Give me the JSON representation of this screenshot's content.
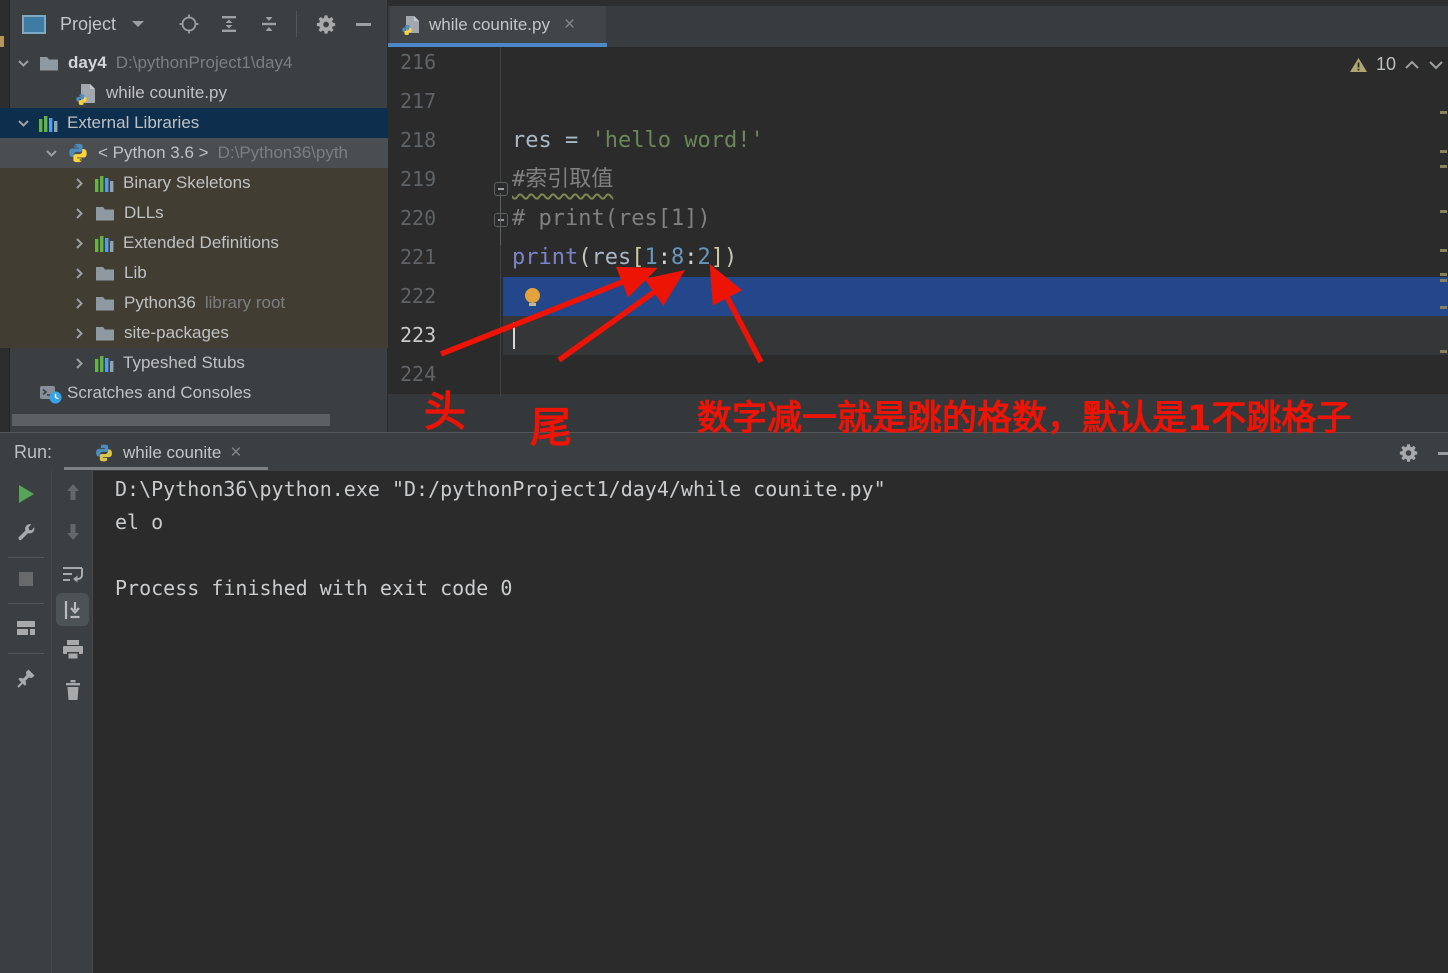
{
  "colors": {
    "selection_blue": "#24468a",
    "tab_accent_blue": "#4a88c7",
    "annotation_red": "#ee1405",
    "string_green": "#6a8759",
    "number_blue": "#6897bb",
    "run_play_green": "#57a558"
  },
  "project_panel": {
    "title": "Project",
    "tree": {
      "day4": {
        "label": "day4",
        "path": "D:\\pythonProject1\\day4"
      },
      "file": "while counite.py",
      "external_libraries": "External Libraries",
      "python36": {
        "label": "< Python 3.6 >",
        "path": "D:\\Python36\\pyth"
      },
      "binary_skeletons": "Binary Skeletons",
      "dlls": "DLLs",
      "extended_definitions": "Extended Definitions",
      "lib": "Lib",
      "python36_dir": {
        "label": "Python36",
        "annotation": "library root"
      },
      "site_packages": "site-packages",
      "typeshed_stubs": "Typeshed Stubs",
      "scratches": "Scratches and Consoles"
    }
  },
  "editor": {
    "tab_title": "while counite.py",
    "close_symbol": "×",
    "warning_count": "10",
    "gutter": [
      "216",
      "217",
      "218",
      "219",
      "220",
      "221",
      "222",
      "223",
      "224"
    ],
    "code": {
      "l218": {
        "var": "res",
        "op": " = ",
        "str": "'hello word!'"
      },
      "l219": {
        "comment": "#索引取值"
      },
      "l220": {
        "comment": "# print(res[1])"
      },
      "l221": {
        "func": "print",
        "lparen": "(",
        "var": "res",
        "lbrack": "[",
        "n1": "1",
        "colon1": ":",
        "n2": "8",
        "colon2": ":",
        "n3": "2",
        "rbrack": "]",
        "rparen": ")"
      }
    }
  },
  "annotations": {
    "head": "头",
    "tail": "尾",
    "note": "数字减一就是跳的格数，默认是1不跳格子"
  },
  "run_panel": {
    "label": "Run:",
    "tab_title": "while counite",
    "close_symbol": "×",
    "console": [
      "D:\\Python36\\python.exe \"D:/pythonProject1/day4/while counite.py\"",
      "el o",
      "",
      "Process finished with exit code 0"
    ]
  }
}
